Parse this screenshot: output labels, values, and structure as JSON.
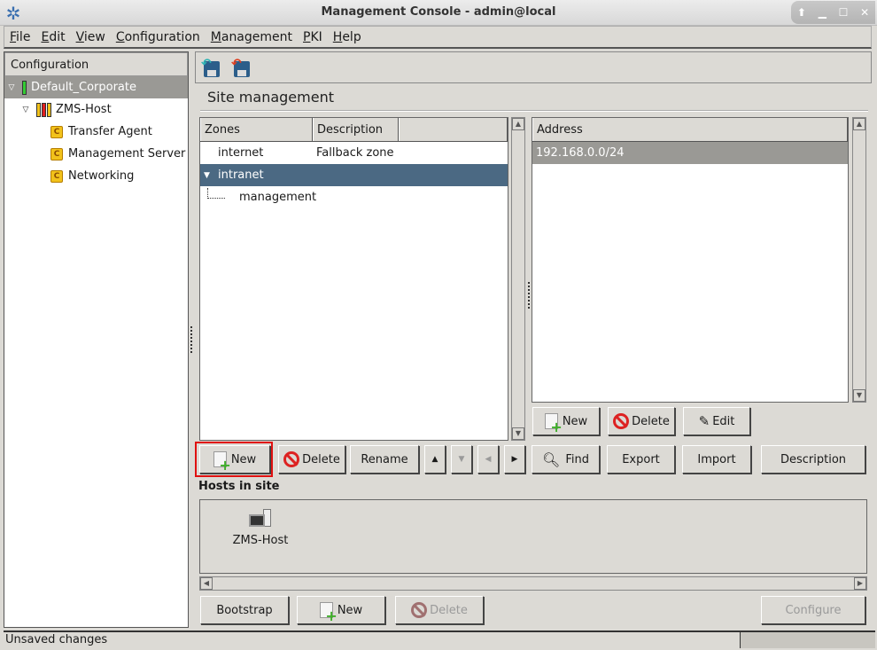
{
  "window": {
    "title": "Management Console - admin@local",
    "controls": [
      "up-arrow",
      "minimize",
      "maximize",
      "close"
    ]
  },
  "menu": [
    {
      "label": "File",
      "mnemonic": "F"
    },
    {
      "label": "Edit",
      "mnemonic": "E"
    },
    {
      "label": "View",
      "mnemonic": "V"
    },
    {
      "label": "Configuration",
      "mnemonic": "C"
    },
    {
      "label": "Management",
      "mnemonic": "M"
    },
    {
      "label": "PKI",
      "mnemonic": "P"
    },
    {
      "label": "Help",
      "mnemonic": "H"
    }
  ],
  "sidebar": {
    "header": "Configuration",
    "items": [
      {
        "label": "Default_Corporate",
        "level": 0,
        "selected": true,
        "icon": "status-green-icon"
      },
      {
        "label": "ZMS-Host",
        "level": 1,
        "icon": "status-yellow-red-yellow-icon"
      },
      {
        "label": "Transfer Agent",
        "level": 2,
        "icon": "component-c-icon"
      },
      {
        "label": "Management Server",
        "level": 2,
        "icon": "component-c-icon"
      },
      {
        "label": "Networking",
        "level": 2,
        "icon": "component-c-icon"
      }
    ]
  },
  "toolbar": {
    "icons": [
      "save-commit-icon",
      "save-revert-icon"
    ]
  },
  "section_title": "Site management",
  "zones": {
    "columns": [
      "Zones",
      "Description",
      ""
    ],
    "rows": [
      {
        "zone": "internet",
        "description": "Fallback zone",
        "level": 0
      },
      {
        "zone": "intranet",
        "description": "",
        "level": 0,
        "expanded": true,
        "selected": true
      },
      {
        "zone": "management",
        "description": "",
        "level": 1
      }
    ]
  },
  "address": {
    "columns": [
      "Address"
    ],
    "rows": [
      {
        "address": "192.168.0.0/24",
        "selected": true
      }
    ]
  },
  "address_buttons": {
    "new": "New",
    "delete": "Delete",
    "edit": "Edit"
  },
  "zone_buttons": {
    "new": "New",
    "delete": "Delete",
    "rename": "Rename",
    "up": "▲",
    "down": "▼",
    "left": "◀",
    "right": "▶",
    "find": "Find",
    "export": "Export",
    "import": "Import",
    "description": "Description"
  },
  "hosts": {
    "label": "Hosts in site",
    "items": [
      {
        "name": "ZMS-Host"
      }
    ]
  },
  "host_buttons": {
    "bootstrap": "Bootstrap",
    "new": "New",
    "delete": "Delete",
    "configure": "Configure"
  },
  "status": {
    "text": "Unsaved changes"
  },
  "colors": {
    "selection": "#4b6983",
    "highlight": "#e01010"
  }
}
